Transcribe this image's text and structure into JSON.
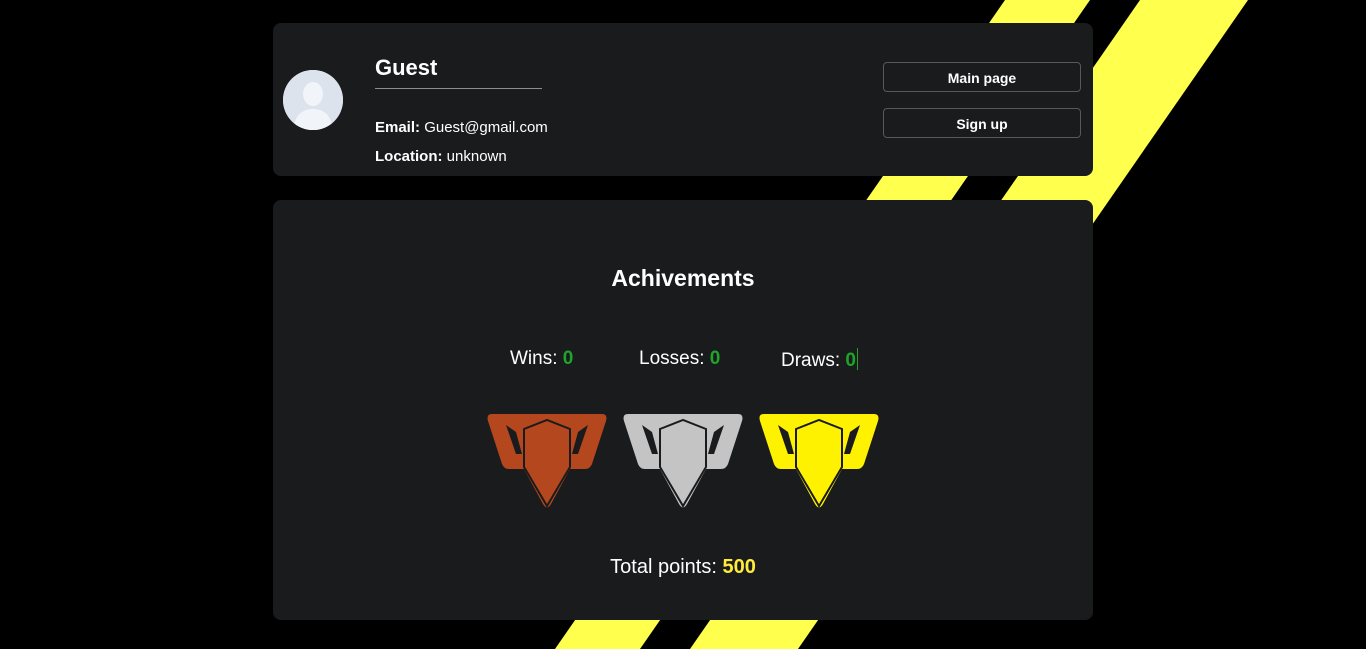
{
  "profile": {
    "username": "Guest",
    "email_label": "Email:",
    "email": "Guest@gmail.com",
    "location_label": "Location:",
    "location": "unknown",
    "avatar_icon": "user-silhouette-icon"
  },
  "nav": {
    "main_page_label": "Main page",
    "sign_up_label": "Sign up"
  },
  "achievements": {
    "title": "Achivements",
    "wins_label": "Wins:",
    "wins": "0",
    "losses_label": "Losses:",
    "losses": "0",
    "draws_label": "Draws:",
    "draws": "0",
    "trophies": [
      {
        "name": "bronze-trophy-icon",
        "color": "#b5471e"
      },
      {
        "name": "silver-trophy-icon",
        "color": "#c4c4c4"
      },
      {
        "name": "gold-trophy-icon",
        "color": "#fff200"
      }
    ],
    "total_label": "Total points:",
    "total_points": "500"
  },
  "colors": {
    "background": "#000000",
    "card": "#1a1b1d",
    "accent_stripe": "#ffff4d",
    "stat_value": "#1fa32a",
    "points": "#ffeb3b"
  }
}
